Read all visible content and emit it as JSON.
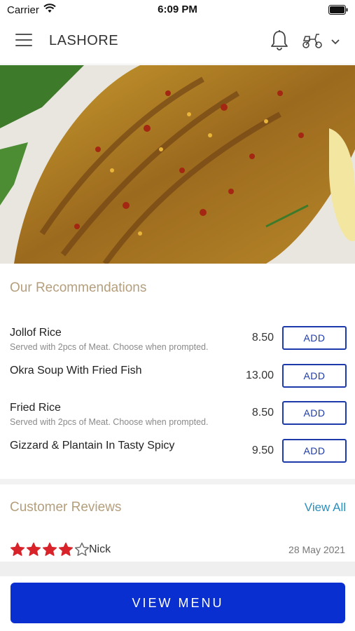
{
  "status_bar": {
    "carrier": "Carrier",
    "time": "6:09 PM"
  },
  "header": {
    "title": "LASHORE"
  },
  "recommendations": {
    "title": "Our Recommendations",
    "items": [
      {
        "name": "Jollof Rice",
        "description": "Served with 2pcs of Meat. Choose when prompted.",
        "price": "8.50",
        "button": "ADD"
      },
      {
        "name": "Okra Soup With Fried Fish",
        "description": "",
        "price": "13.00",
        "button": "ADD"
      },
      {
        "name": "Fried Rice",
        "description": "Served with 2pcs of Meat. Choose when prompted.",
        "price": "8.50",
        "button": "ADD"
      },
      {
        "name": "Gizzard & Plantain In Tasty Spicy",
        "description": "",
        "price": "9.50",
        "button": "ADD"
      }
    ]
  },
  "reviews": {
    "title": "Customer Reviews",
    "view_all": "View All",
    "items": [
      {
        "reviewer": "Nick",
        "rating": 4,
        "max_rating": 5,
        "date": "28 May 2021"
      }
    ]
  },
  "footer": {
    "view_menu": "VIEW MENU"
  },
  "colors": {
    "accent": "#1d3aad",
    "primary_button": "#0a2fd0",
    "section_title": "#b49e7c",
    "link": "#2a8fbd",
    "star": "#d8232a"
  }
}
